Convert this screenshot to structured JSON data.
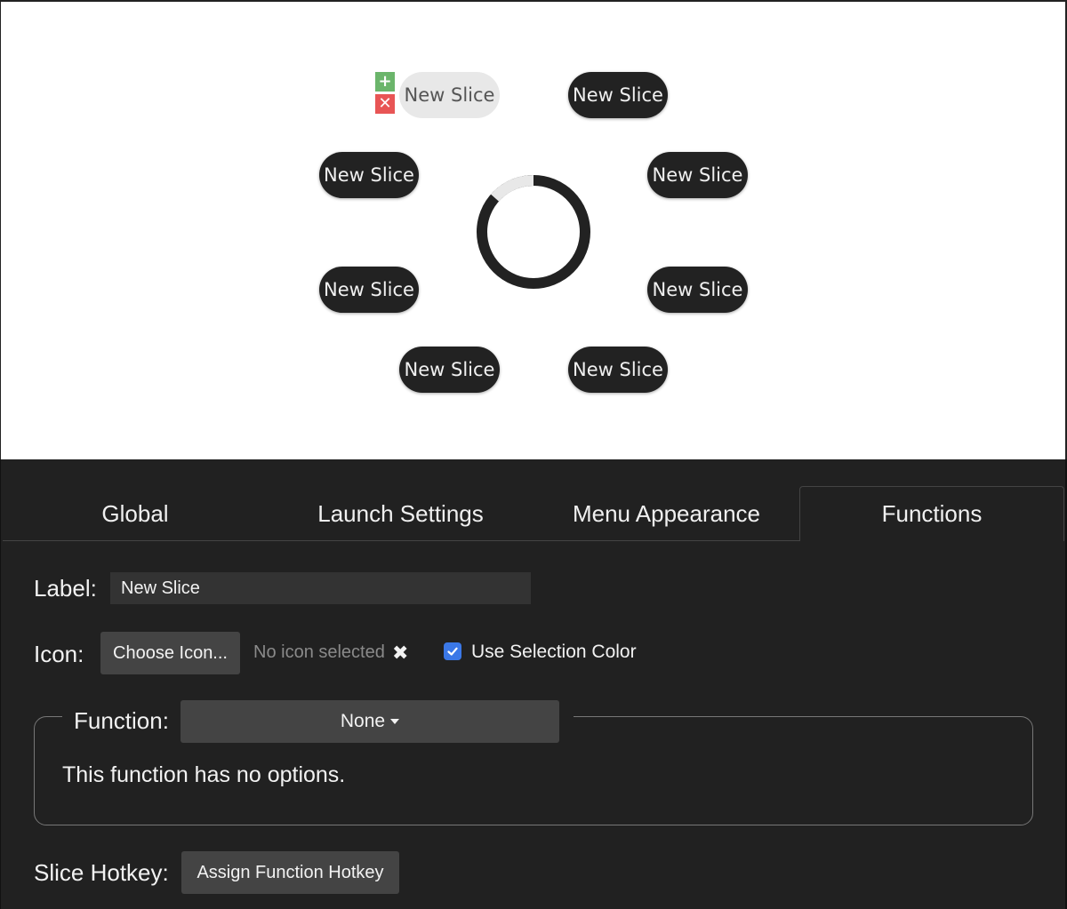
{
  "preview": {
    "slices": [
      {
        "label": "New Slice",
        "selected": true
      },
      {
        "label": "New Slice",
        "selected": false
      },
      {
        "label": "New Slice",
        "selected": false
      },
      {
        "label": "New Slice",
        "selected": false
      },
      {
        "label": "New Slice",
        "selected": false
      },
      {
        "label": "New Slice",
        "selected": false
      },
      {
        "label": "New Slice",
        "selected": false
      },
      {
        "label": "New Slice",
        "selected": false
      }
    ],
    "slice_controls": {
      "add": "+",
      "remove": "✕"
    },
    "colors": {
      "slice_bg": "#222222",
      "slice_text": "#f0f0f0",
      "selected_bg": "#e8e8e8",
      "selected_text": "#555555",
      "add": "#6bb56b",
      "remove": "#e85555"
    }
  },
  "tabs": [
    {
      "label": "Global",
      "active": false
    },
    {
      "label": "Launch Settings",
      "active": false
    },
    {
      "label": "Menu Appearance",
      "active": false
    },
    {
      "label": "Functions",
      "active": true
    }
  ],
  "form": {
    "label_label": "Label:",
    "label_value": "New Slice",
    "icon_label": "Icon:",
    "choose_icon_button": "Choose Icon...",
    "no_icon_text": "No icon selected",
    "clear_icon": "✖",
    "use_selection_color_label": "Use Selection Color",
    "use_selection_color_checked": true,
    "function_label": "Function:",
    "function_value": "None",
    "no_options_text": "This function has no options.",
    "hotkey_label": "Slice Hotkey:",
    "hotkey_button": "Assign Function Hotkey"
  },
  "colors": {
    "panel_bg": "#212121",
    "control_bg": "#444444",
    "input_bg": "#333333",
    "accent": "#3b78e7"
  }
}
